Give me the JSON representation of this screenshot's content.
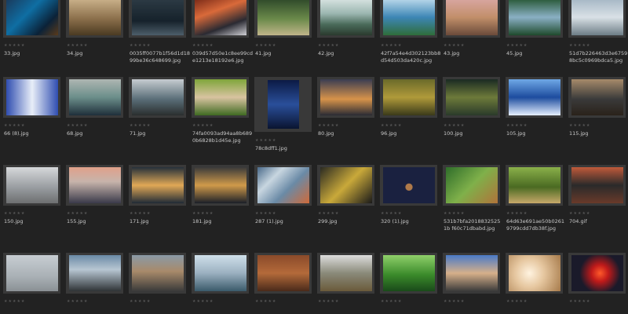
{
  "app": {
    "stars_glyph": "★★★★★"
  },
  "rows": [
    {
      "items": [
        {
          "name": "33.jpg",
          "thumb": "linear-gradient(135deg,#1a3a5c,#0f6ea3 40%,#0b2238 75%,#5a3a1a)"
        },
        {
          "name": "34.jpg",
          "thumb": "linear-gradient(180deg,#c9b089,#8a6e4a 55%,#4a3a22)"
        },
        {
          "name": "0035ff0077b1f56d1d1899be36c648699.jpg",
          "thumb": "linear-gradient(180deg,#2c3a44,#16222b 60%,#4d5e6a)"
        },
        {
          "name": "039d57d50e1c8ee99cde1213e18192e6.jpg",
          "thumb": "linear-gradient(160deg,#7a2a18,#d96a3a 35%,#2a2a32 70%,#cfcfd4)"
        },
        {
          "name": "41.jpg",
          "thumb": "linear-gradient(180deg,#2f4a2a,#6b8a4a 55%,#c0b58a)"
        },
        {
          "name": "42.jpg",
          "thumb": "linear-gradient(180deg,#d6e2e0,#9bb6b0 40%,#4a6b5a 70%,#2a3a2e)"
        },
        {
          "name": "42f7a54e4d302123bb8d54d503da420c.jpg",
          "thumb": "linear-gradient(180deg,#b8d7ea,#3d86b5 50%,#2f6d3a)"
        },
        {
          "name": "43.jpg",
          "thumb": "linear-gradient(180deg,#d8a6a0,#c28f6a 50%,#6a4a3a)"
        },
        {
          "name": "45.jpg",
          "thumb": "linear-gradient(180deg,#2a5a3a,#8ab0c4 50%,#1f4a2c)"
        },
        {
          "name": "51d7b226463d3e67598bc5c0969bdca5.jpg",
          "thumb": "linear-gradient(180deg,#a7b8c6,#d9e1e6 50%,#6d7d86)"
        }
      ]
    },
    {
      "items": [
        {
          "name": "66 (8).jpg",
          "thumb": "linear-gradient(90deg,#2f4db0,#e8eef8 50%,#2f4db0)"
        },
        {
          "name": "68.jpg",
          "thumb": "linear-gradient(180deg,#aeb6b2,#6b8e8a 50%,#1f2f3a)"
        },
        {
          "name": "71.jpg",
          "thumb": "linear-gradient(180deg,#c6ccd0,#5a6e78 55%,#2a2e2e)"
        },
        {
          "name": "74fa0093ad94aa8b6890b6828b1d45e.jpg",
          "thumb": "linear-gradient(180deg,#7fa53a,#d8c3a0 50%,#3f6a22)"
        },
        {
          "name": "78c8dff1.jpg",
          "thumb": "linear-gradient(180deg,#0b1a45,#2a4f9a 50%,#0a1430)",
          "portrait": true
        },
        {
          "name": "80.jpg",
          "thumb": "linear-gradient(180deg,#3a3d52,#d7934a 55%,#2a2b34)"
        },
        {
          "name": "96.jpg",
          "thumb": "linear-gradient(180deg,#6a6a2a,#b09a3a 50%,#3a3a1a)"
        },
        {
          "name": "100.jpg",
          "thumb": "linear-gradient(180deg,#1a2a22,#6d7a3a 50%,#2a3a2a)"
        },
        {
          "name": "105.jpg",
          "thumb": "linear-gradient(180deg,#6fa8e6,#1d4c9e 50%,#e6f0ff)"
        },
        {
          "name": "115.jpg",
          "thumb": "linear-gradient(180deg,#a68a6a,#3a3a3a 55%,#2a221a)"
        }
      ]
    },
    {
      "items": [
        {
          "name": "150.jpg",
          "thumb": "linear-gradient(180deg,#d6d8da,#9a9ea2 55%,#6d6f70)"
        },
        {
          "name": "155.jpg",
          "thumb": "linear-gradient(180deg,#e0a08a,#c7b4ab 40%,#3a3a4a)"
        },
        {
          "name": "171.jpg",
          "thumb": "linear-gradient(180deg,#25303a,#e0a856 50%,#1f2a36)"
        },
        {
          "name": "181.jpg",
          "thumb": "linear-gradient(180deg,#3a3a3a,#d09a4a 50%,#1a1f28)"
        },
        {
          "name": "287 (1).jpg",
          "thumb": "linear-gradient(135deg,#4a6a8a,#c8d6e0 30%,#6a8aa6 60%,#cf6a3a)"
        },
        {
          "name": "299.jpg",
          "thumb": "linear-gradient(135deg,#2a2a22,#c9a93a 50%,#1a1a1a)"
        },
        {
          "name": "320 (1).jpg",
          "thumb": "radial-gradient(circle at 50% 55%,#b07a4a 0 10%,#1a2140 12% 100%)"
        },
        {
          "name": "531b7bfa2018832525 1b f60c71dbabd.jpg",
          "thumb": "linear-gradient(135deg,#2f6d2a,#7fb04a 50%,#b0733a)"
        },
        {
          "name": "64d63e691ae50b02619799cdd7db38f.jpg",
          "thumb": "linear-gradient(180deg,#8ab04a,#4a6a22 55%,#c7a96a)"
        },
        {
          "name": "704.gif",
          "thumb": "linear-gradient(180deg,#c05a3a,#2a2a2a 50%,#6a3a2a)"
        }
      ]
    },
    {
      "items": [
        {
          "name": "",
          "thumb": "linear-gradient(180deg,#c7cdd2,#a9b0b5 60%,#8a9094)"
        },
        {
          "name": "",
          "thumb": "linear-gradient(180deg,#6a8aa6,#b7c6d2 40%,#2f3336)"
        },
        {
          "name": "",
          "thumb": "linear-gradient(180deg,#8a9aa6,#a88a6a 45%,#3a3a3a)"
        },
        {
          "name": "",
          "thumb": "linear-gradient(180deg,#cfe0ea,#9bb0c0 50%,#3a5a6a)"
        },
        {
          "name": "",
          "thumb": "linear-gradient(180deg,#8a4a2a,#b46a3a 50%,#4a2a1a)"
        },
        {
          "name": "",
          "thumb": "linear-gradient(180deg,#dcdcdc,#8a8a7a 50%,#6a5a3a)"
        },
        {
          "name": "",
          "thumb": "linear-gradient(180deg,#8fd06a,#3a8a2a 55%,#1a4a1a)"
        },
        {
          "name": "",
          "thumb": "linear-gradient(180deg,#4a7ac6,#d6b08a 50%,#3a3a3a)"
        },
        {
          "name": "",
          "thumb": "radial-gradient(circle at 40% 50%,#fff3e0,#e6c7a0 40%,#a67a4a)"
        },
        {
          "name": "",
          "thumb": "radial-gradient(circle at 55% 50%,#ff5a2a,#c01a1a 25%,#1a1a2a 60%)"
        }
      ]
    }
  ]
}
